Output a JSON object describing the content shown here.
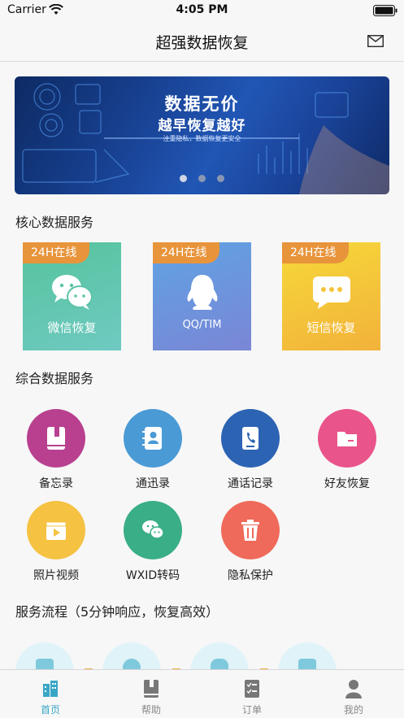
{
  "status_bar": {
    "carrier": "Carrier",
    "time": "4:05 PM"
  },
  "nav": {
    "title": "超强数据恢复",
    "mail_icon": "mail-icon"
  },
  "banner": {
    "title": "数据无价",
    "subtitle": "越早恢复越好",
    "note": "注重隐私，数据恢复更安全",
    "pages": 3,
    "active_page": 0
  },
  "core_section": {
    "title": "核心数据服务",
    "cards": [
      {
        "badge": "24H在线",
        "label": "微信恢复",
        "icon": "wechat-icon",
        "color": "#5cc3a8"
      },
      {
        "badge": "24H在线",
        "label": "QQ/TIM",
        "icon": "qq-icon",
        "color": "#6fa8e0"
      },
      {
        "badge": "24H在线",
        "label": "短信恢复",
        "icon": "sms-icon",
        "color": "#f5c531"
      }
    ]
  },
  "general_section": {
    "title": "综合数据服务",
    "items": [
      {
        "label": "备忘录",
        "icon": "memo-icon",
        "color": "#b8408f"
      },
      {
        "label": "通迅录",
        "icon": "contacts-icon",
        "color": "#4a9ad6"
      },
      {
        "label": "通话记录",
        "icon": "call-log-icon",
        "color": "#2c63b3"
      },
      {
        "label": "好友恢复",
        "icon": "folder-icon",
        "color": "#e9548b"
      },
      {
        "label": "照片视频",
        "icon": "video-icon",
        "color": "#f5c242"
      },
      {
        "label": "WXID转码",
        "icon": "wechat-icon",
        "color": "#3aae86"
      },
      {
        "label": "隐私保护",
        "icon": "trash-icon",
        "color": "#ef6a5a"
      }
    ]
  },
  "flow_section": {
    "title": "服务流程（5分钟响应，恢复高效）"
  },
  "tabbar": {
    "active": 0,
    "tabs": [
      {
        "label": "首页",
        "icon": "home-icon"
      },
      {
        "label": "帮助",
        "icon": "help-book-icon"
      },
      {
        "label": "订单",
        "icon": "order-icon"
      },
      {
        "label": "我的",
        "icon": "profile-icon"
      }
    ]
  }
}
